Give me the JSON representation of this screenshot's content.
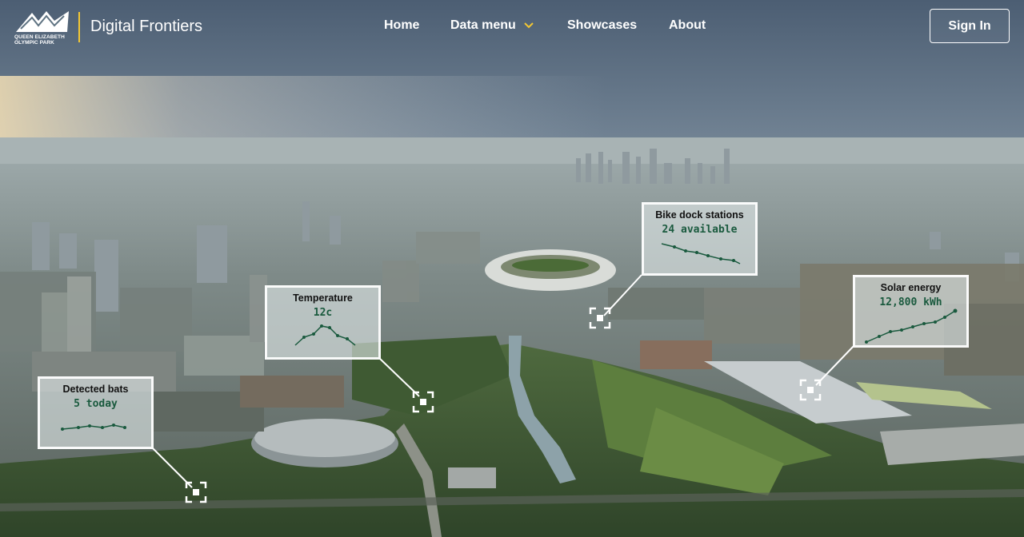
{
  "brand": {
    "logo_text": "QUEEN ELIZABETH OLYMPIC PARK",
    "site_title": "Digital Frontiers",
    "accent_color": "#f3c733"
  },
  "nav": {
    "home": "Home",
    "data_menu": "Data menu",
    "showcases": "Showcases",
    "about": "About"
  },
  "auth": {
    "sign_in": "Sign In"
  },
  "cards": {
    "bats": {
      "title": "Detected bats",
      "value": "5 today",
      "icon": "sparkline",
      "color": "#1a5a3e"
    },
    "temperature": {
      "title": "Temperature",
      "value": "12c",
      "icon": "sparkline",
      "color": "#1a5a3e"
    },
    "bikes": {
      "title": "Bike dock stations",
      "value": "24 available",
      "icon": "sparkline",
      "color": "#1a5a3e"
    },
    "solar": {
      "title": "Solar energy",
      "value": "12,800 kWh",
      "icon": "sparkline",
      "color": "#1a5a3e"
    }
  }
}
